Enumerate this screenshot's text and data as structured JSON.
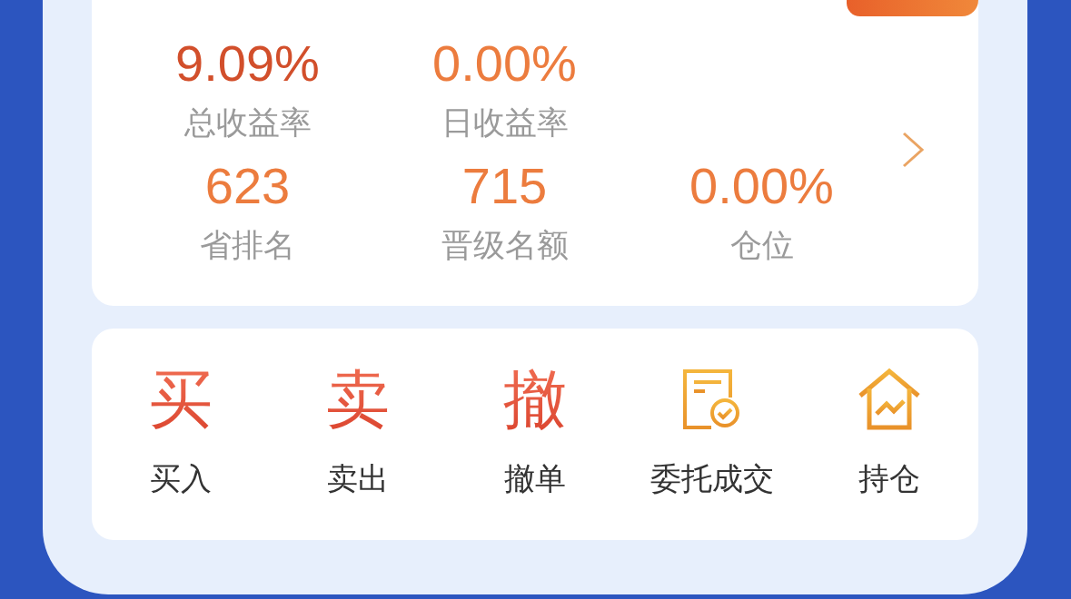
{
  "stats_card": {
    "rows": [
      [
        {
          "value": "9.09%",
          "label": "总收益率",
          "color": "#d24f2b"
        },
        {
          "value": "0.00%",
          "label": "日收益率",
          "color": "#ec7c3e"
        }
      ],
      [
        {
          "value": "623",
          "label": "省排名",
          "color": "#ec7c3e"
        },
        {
          "value": "715",
          "label": "晋级名额",
          "color": "#ec7c3e"
        },
        {
          "value": "0.00%",
          "label": "仓位",
          "color": "#ec7c3e"
        }
      ]
    ]
  },
  "actions": [
    {
      "kind": "glyph",
      "glyph": "买",
      "label": "买入"
    },
    {
      "kind": "glyph",
      "glyph": "卖",
      "label": "卖出"
    },
    {
      "kind": "glyph",
      "glyph": "撤",
      "label": "撤单"
    },
    {
      "kind": "document",
      "label": "委托成交"
    },
    {
      "kind": "house",
      "label": "持仓"
    }
  ]
}
